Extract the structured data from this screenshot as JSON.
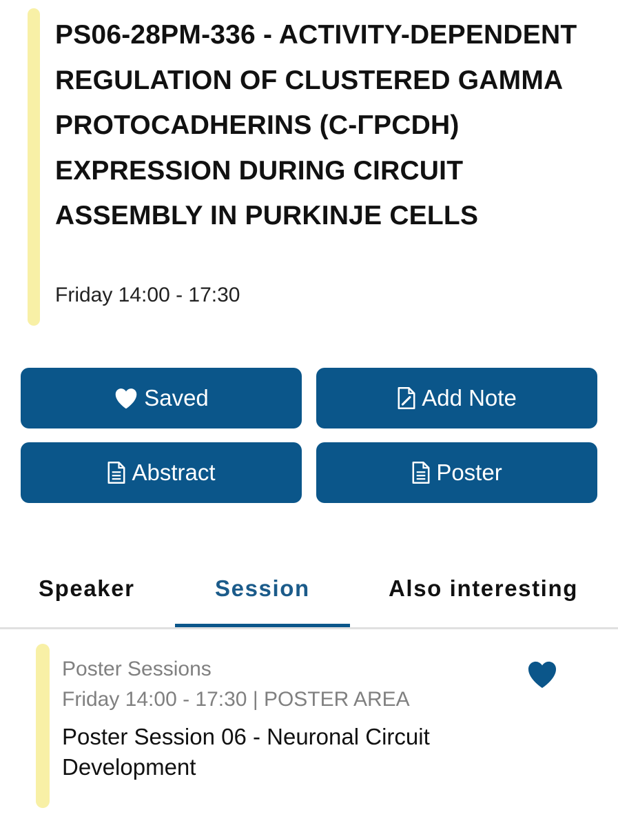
{
  "header": {
    "title": "PS06-28PM-336 - ACTIVITY-DEPENDENT REGULATION OF CLUSTERED GAMMA PROTOCADHERINS (C-ΓPCDH) EXPRESSION DURING CIRCUIT ASSEMBLY IN PURKINJE CELLS",
    "time": "Friday 14:00 - 17:30",
    "accent_color": "#f8f0a6"
  },
  "actions": {
    "saved": {
      "label": "Saved",
      "icon": "heart-icon"
    },
    "add_note": {
      "label": "Add Note",
      "icon": "edit-note-icon"
    },
    "abstract": {
      "label": "Abstract",
      "icon": "document-icon"
    },
    "poster": {
      "label": "Poster",
      "icon": "document-icon"
    },
    "button_color": "#0b568a"
  },
  "tabs": [
    {
      "label": "Speaker",
      "active": false
    },
    {
      "label": "Session",
      "active": true
    },
    {
      "label": "Also interesting",
      "active": false
    }
  ],
  "session": {
    "type": "Poster Sessions",
    "when": "Friday 14:00 - 17:30 | POSTER AREA",
    "name": "Poster Session 06 - Neuronal Circuit Development",
    "favorite": true,
    "favorite_icon": "heart-icon"
  }
}
